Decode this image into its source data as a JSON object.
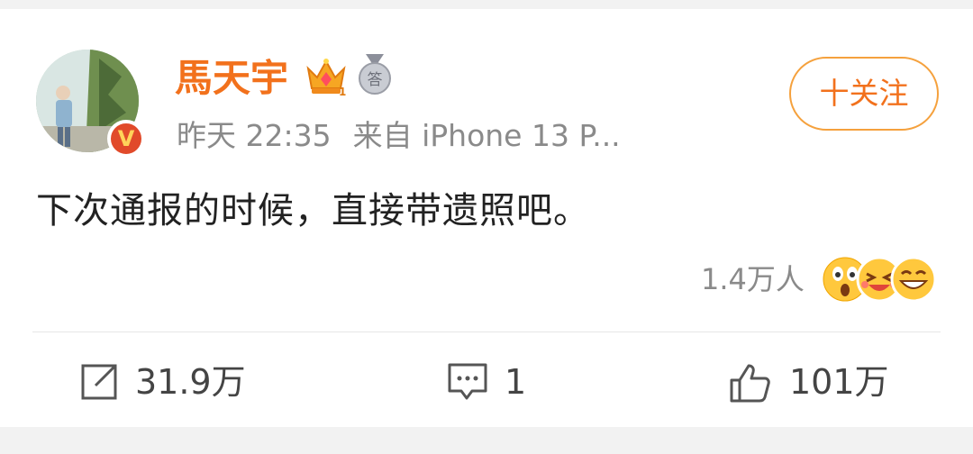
{
  "post": {
    "author": "馬天宇",
    "verified_badge": "V",
    "time": "昨天 22:35",
    "source": "来自 iPhone 13 P...",
    "follow_label": "十关注",
    "text": "下次通报的时候，直接带遗照吧。",
    "reaction_count": "1.4万人",
    "reactions": [
      "surprised-emoji",
      "laughing-emoji",
      "grinning-emoji"
    ]
  },
  "actions": {
    "repost_count": "31.9万",
    "comment_count": "1",
    "like_count": "101万"
  },
  "colors": {
    "username": "#f2711c",
    "follow_border": "#f5a13d",
    "muted": "#8a8a8a"
  }
}
